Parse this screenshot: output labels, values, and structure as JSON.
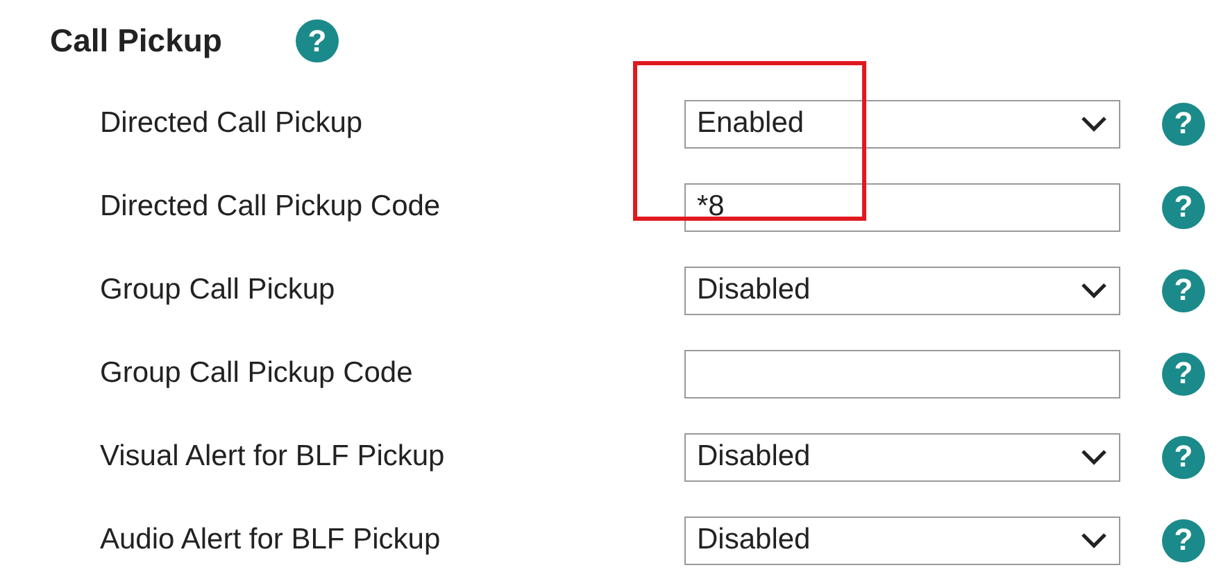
{
  "section": {
    "title": "Call Pickup",
    "help": "?"
  },
  "rows": [
    {
      "label": "Directed Call Pickup",
      "kind": "select",
      "value": "Enabled",
      "highlighted": true,
      "help": "?"
    },
    {
      "label": "Directed Call Pickup Code",
      "kind": "text",
      "value": "*8",
      "highlighted": true,
      "help": "?"
    },
    {
      "label": "Group Call Pickup",
      "kind": "select",
      "value": "Disabled",
      "highlighted": false,
      "help": "?"
    },
    {
      "label": "Group Call Pickup Code",
      "kind": "text",
      "value": "",
      "highlighted": false,
      "help": "?"
    },
    {
      "label": "Visual Alert for BLF Pickup",
      "kind": "select",
      "value": "Disabled",
      "highlighted": false,
      "help": "?"
    },
    {
      "label": "Audio Alert for BLF Pickup",
      "kind": "select",
      "value": "Disabled",
      "highlighted": false,
      "help": "?"
    }
  ]
}
